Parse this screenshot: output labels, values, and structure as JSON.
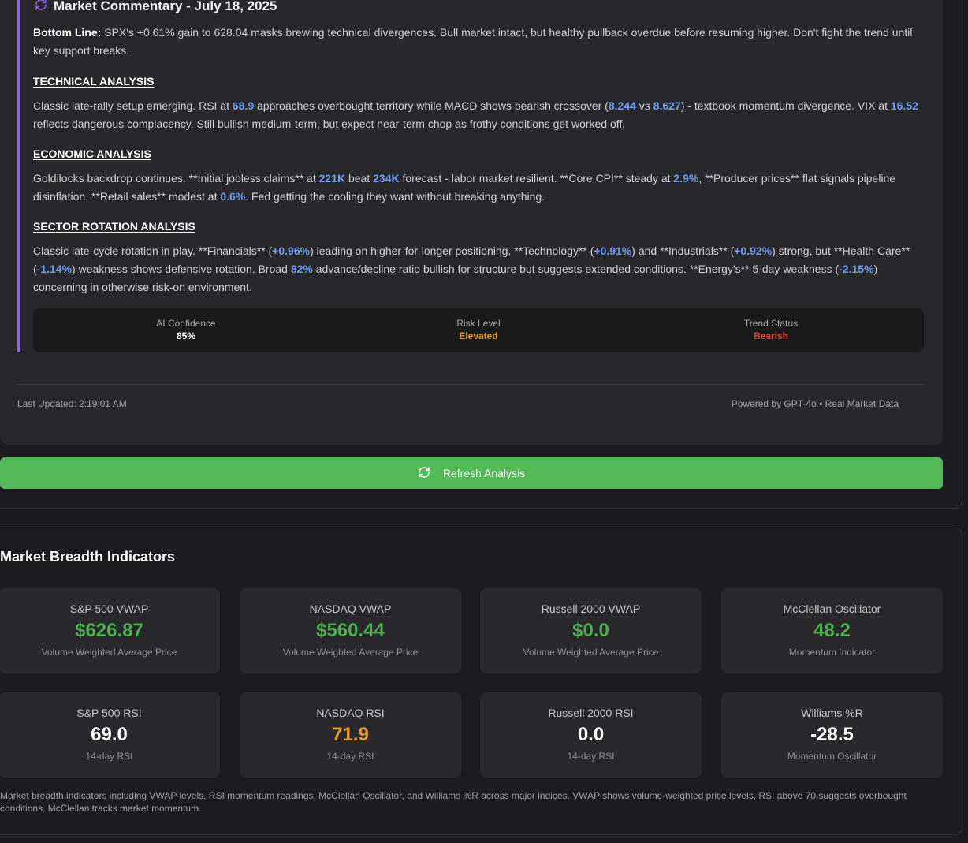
{
  "commentary": {
    "title": "Market Commentary - July 18, 2025",
    "bottom_line_label": "Bottom Line:",
    "bottom_line_text": " SPX's +0.61% gain to 628.04 masks brewing technical divergences. Bull market intact, but healthy pullback overdue before resuming higher. Don't fight the trend until key support breaks.",
    "technical": {
      "heading": "TECHNICAL ANALYSIS",
      "t1": "Classic late-rally setup emerging. RSI at ",
      "v1": "68.9",
      "t2": " approaches overbought territory while MACD shows bearish crossover (",
      "v2": "8.244",
      "t3": " vs ",
      "v3": "8.627",
      "t4": ") - textbook momentum divergence. VIX at ",
      "v4": "16.52",
      "t5": " reflects dangerous complacency. Still bullish medium-term, but expect near-term chop as frothy conditions get worked off."
    },
    "economic": {
      "heading": "ECONOMIC ANALYSIS",
      "t1": "Goldilocks backdrop continues. **Initial jobless claims** at ",
      "v1": "221K",
      "t2": " beat ",
      "v2": "234K",
      "t3": " forecast - labor market resilient. **Core CPI** steady at ",
      "v3": "2.9%",
      "t4": ", **Producer prices** flat signals pipeline disinflation. **Retail sales** modest at ",
      "v4": "0.6%",
      "t5": ". Fed getting the cooling they want without breaking anything."
    },
    "sector": {
      "heading": "SECTOR ROTATION ANALYSIS",
      "t1": "Classic late-cycle rotation in play. **Financials** (",
      "v1": "+0.96%",
      "t2": ") leading on higher-for-longer positioning. **Technology** (",
      "v2": "+0.91%",
      "t3": ") and **Industrials** (",
      "v3": "+0.92%",
      "t4": ") strong, but **Health Care** (",
      "v4": "-1.14%",
      "t5": ") weakness shows defensive rotation. Broad ",
      "v5": "82%",
      "t6": " advance/decline ratio bullish for structure but suggests extended conditions. **Energy's** 5-day weakness (",
      "v6": "-2.15%",
      "t7": ") concerning in otherwise risk-on environment."
    },
    "stats": [
      {
        "label": "AI Confidence",
        "value": "85%",
        "color": "#ffffff"
      },
      {
        "label": "Risk Level",
        "value": "Elevated",
        "color": "#e79b26"
      },
      {
        "label": "Trend Status",
        "value": "Bearish",
        "color": "#e0483e"
      }
    ],
    "last_updated": "Last Updated: 2:19:01 AM",
    "powered_by": "Powered by GPT-4o • Real Market Data",
    "accent_color": "#9160e8"
  },
  "refresh_button": {
    "label": "Refresh Analysis",
    "color": "#52b957"
  },
  "breadth": {
    "title": "Market Breadth Indicators",
    "metrics": [
      {
        "name": "S&P 500 VWAP",
        "value": "$626.87",
        "sub": "Volume Weighted Average Price",
        "color": "#4cb050"
      },
      {
        "name": "NASDAQ VWAP",
        "value": "$560.44",
        "sub": "Volume Weighted Average Price",
        "color": "#4cb050"
      },
      {
        "name": "Russell 2000 VWAP",
        "value": "$0.0",
        "sub": "Volume Weighted Average Price",
        "color": "#4cb050"
      },
      {
        "name": "McClellan Oscillator",
        "value": "48.2",
        "sub": "Momentum Indicator",
        "color": "#4cb050"
      },
      {
        "name": "S&P 500 RSI",
        "value": "69.0",
        "sub": "14-day RSI",
        "color": "#ffffff"
      },
      {
        "name": "NASDAQ RSI",
        "value": "71.9",
        "sub": "14-day RSI",
        "color": "#e79b26"
      },
      {
        "name": "Russell 2000 RSI",
        "value": "0.0",
        "sub": "14-day RSI",
        "color": "#ffffff"
      },
      {
        "name": "Williams %R",
        "value": "-28.5",
        "sub": "Momentum Oscillator",
        "color": "#ffffff"
      }
    ],
    "note": "Market breadth indicators including VWAP levels, RSI momentum readings, McClellan Oscillator, and Williams %R across major indices. VWAP shows volume-weighted price levels, RSI above 70 suggests overbought conditions, McClellan tracks market momentum."
  }
}
